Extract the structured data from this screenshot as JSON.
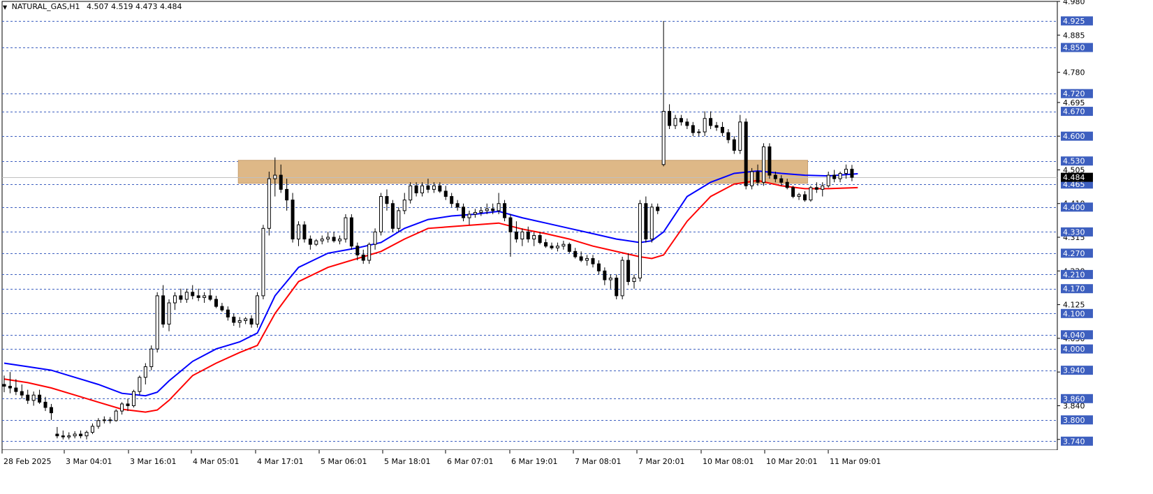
{
  "header": {
    "symbol": "NATURAL_GAS,H1",
    "ohlc": "4.507 4.519 4.473 4.484"
  },
  "colors": {
    "grid": "#3d5fbf",
    "candle": "#000000",
    "ema_fast": "#0000ff",
    "ema_slow": "#ff0000",
    "zone": "#deb887",
    "label_bg": "#3d5fbf",
    "last_price_bg": "#000000"
  },
  "chart_data": {
    "type": "candlestick",
    "ylim": [
      3.715,
      4.98
    ],
    "x_tick_labels": [
      "28 Feb 2025",
      "3 Mar 04:01",
      "3 Mar 16:01",
      "4 Mar 05:01",
      "4 Mar 17:01",
      "5 Mar 06:01",
      "5 Mar 18:01",
      "6 Mar 07:01",
      "6 Mar 19:01",
      "7 Mar 08:01",
      "7 Mar 20:01",
      "10 Mar 08:01",
      "10 Mar 20:01",
      "11 Mar 09:01"
    ],
    "y_axis_labels": [
      "4.980",
      "4.885",
      "4.780",
      "4.695",
      "4.600",
      "4.505",
      "4.410",
      "4.315",
      "4.220",
      "4.125",
      "4.030",
      "3.935",
      "3.840",
      "3.745"
    ],
    "grid_levels": [
      "4.925",
      "4.850",
      "4.720",
      "4.670",
      "4.600",
      "4.530",
      "4.465",
      "4.400",
      "4.330",
      "4.270",
      "4.210",
      "4.170",
      "4.100",
      "4.040",
      "4.000",
      "3.940",
      "3.860",
      "3.800",
      "3.740"
    ],
    "last_price": "4.484",
    "zone": {
      "x_start": 40,
      "x_end": 136,
      "y_low": 4.467,
      "y_high": 4.532
    },
    "candles": [
      [
        3.9,
        3.925,
        3.878,
        3.895
      ],
      [
        3.895,
        3.935,
        3.875,
        3.89
      ],
      [
        3.89,
        3.915,
        3.87,
        3.88
      ],
      [
        3.88,
        3.9,
        3.86,
        3.87
      ],
      [
        3.87,
        3.885,
        3.845,
        3.855
      ],
      [
        3.855,
        3.88,
        3.84,
        3.87
      ],
      [
        3.87,
        3.885,
        3.845,
        3.85
      ],
      [
        3.85,
        3.865,
        3.825,
        3.835
      ],
      [
        3.835,
        3.845,
        3.8,
        3.82
      ],
      [
        3.76,
        3.78,
        3.748,
        3.755
      ],
      [
        3.755,
        3.77,
        3.745,
        3.752
      ],
      [
        3.752,
        3.765,
        3.745,
        3.755
      ],
      [
        3.755,
        3.768,
        3.748,
        3.76
      ],
      [
        3.76,
        3.77,
        3.748,
        3.755
      ],
      [
        3.755,
        3.77,
        3.745,
        3.765
      ],
      [
        3.765,
        3.79,
        3.76,
        3.782
      ],
      [
        3.782,
        3.805,
        3.775,
        3.798
      ],
      [
        3.798,
        3.81,
        3.79,
        3.8
      ],
      [
        3.8,
        3.808,
        3.79,
        3.798
      ],
      [
        3.798,
        3.83,
        3.795,
        3.825
      ],
      [
        3.825,
        3.85,
        3.815,
        3.845
      ],
      [
        3.845,
        3.86,
        3.825,
        3.84
      ],
      [
        3.84,
        3.885,
        3.835,
        3.88
      ],
      [
        3.88,
        3.925,
        3.87,
        3.92
      ],
      [
        3.92,
        3.96,
        3.9,
        3.95
      ],
      [
        3.95,
        4.01,
        3.94,
        4.0
      ],
      [
        4.0,
        4.16,
        3.99,
        4.15
      ],
      [
        4.15,
        4.18,
        4.06,
        4.07
      ],
      [
        4.07,
        4.14,
        4.05,
        4.13
      ],
      [
        4.13,
        4.16,
        4.11,
        4.15
      ],
      [
        4.15,
        4.17,
        4.13,
        4.14
      ],
      [
        4.14,
        4.17,
        4.13,
        4.16
      ],
      [
        4.16,
        4.18,
        4.14,
        4.15
      ],
      [
        4.15,
        4.17,
        4.135,
        4.145
      ],
      [
        4.145,
        4.16,
        4.13,
        4.15
      ],
      [
        4.15,
        4.17,
        4.135,
        4.14
      ],
      [
        4.14,
        4.15,
        4.115,
        4.12
      ],
      [
        4.12,
        4.13,
        4.105,
        4.11
      ],
      [
        4.11,
        4.12,
        4.08,
        4.09
      ],
      [
        4.09,
        4.1,
        4.065,
        4.075
      ],
      [
        4.075,
        4.09,
        4.06,
        4.08
      ],
      [
        4.08,
        4.09,
        4.07,
        4.085
      ],
      [
        4.085,
        4.095,
        4.06,
        4.07
      ],
      [
        4.07,
        4.16,
        4.06,
        4.15
      ],
      [
        4.15,
        4.35,
        4.14,
        4.34
      ],
      [
        4.34,
        4.5,
        4.32,
        4.48
      ],
      [
        4.48,
        4.54,
        4.43,
        4.49
      ],
      [
        4.49,
        4.52,
        4.44,
        4.45
      ],
      [
        4.45,
        4.48,
        4.39,
        4.42
      ],
      [
        4.42,
        4.44,
        4.3,
        4.31
      ],
      [
        4.31,
        4.36,
        4.29,
        4.35
      ],
      [
        4.35,
        4.36,
        4.3,
        4.31
      ],
      [
        4.31,
        4.32,
        4.28,
        4.295
      ],
      [
        4.295,
        4.31,
        4.29,
        4.305
      ],
      [
        4.305,
        4.32,
        4.295,
        4.31
      ],
      [
        4.31,
        4.33,
        4.3,
        4.315
      ],
      [
        4.315,
        4.33,
        4.3,
        4.305
      ],
      [
        4.305,
        4.32,
        4.295,
        4.31
      ],
      [
        4.31,
        4.38,
        4.3,
        4.37
      ],
      [
        4.37,
        4.38,
        4.28,
        4.29
      ],
      [
        4.29,
        4.3,
        4.25,
        4.265
      ],
      [
        4.265,
        4.28,
        4.24,
        4.25
      ],
      [
        4.25,
        4.3,
        4.24,
        4.295
      ],
      [
        4.295,
        4.34,
        4.28,
        4.33
      ],
      [
        4.33,
        4.44,
        4.32,
        4.43
      ],
      [
        4.43,
        4.45,
        4.39,
        4.41
      ],
      [
        4.41,
        4.42,
        4.33,
        4.34
      ],
      [
        4.34,
        4.4,
        4.33,
        4.39
      ],
      [
        4.39,
        4.44,
        4.38,
        4.42
      ],
      [
        4.42,
        4.47,
        4.41,
        4.46
      ],
      [
        4.46,
        4.47,
        4.43,
        4.44
      ],
      [
        4.44,
        4.47,
        4.43,
        4.46
      ],
      [
        4.46,
        4.48,
        4.44,
        4.45
      ],
      [
        4.45,
        4.47,
        4.44,
        4.46
      ],
      [
        4.46,
        4.47,
        4.44,
        4.445
      ],
      [
        4.445,
        4.46,
        4.42,
        4.43
      ],
      [
        4.43,
        4.44,
        4.4,
        4.41
      ],
      [
        4.41,
        4.42,
        4.39,
        4.4
      ],
      [
        4.4,
        4.41,
        4.36,
        4.37
      ],
      [
        4.37,
        4.39,
        4.35,
        4.38
      ],
      [
        4.38,
        4.395,
        4.37,
        4.385
      ],
      [
        4.385,
        4.4,
        4.375,
        4.39
      ],
      [
        4.39,
        4.41,
        4.38,
        4.395
      ],
      [
        4.395,
        4.41,
        4.38,
        4.39
      ],
      [
        4.39,
        4.44,
        4.38,
        4.41
      ],
      [
        4.41,
        4.42,
        4.36,
        4.37
      ],
      [
        4.37,
        4.38,
        4.26,
        4.33
      ],
      [
        4.33,
        4.36,
        4.3,
        4.31
      ],
      [
        4.31,
        4.34,
        4.29,
        4.33
      ],
      [
        4.33,
        4.345,
        4.3,
        4.31
      ],
      [
        4.31,
        4.33,
        4.29,
        4.32
      ],
      [
        4.32,
        4.33,
        4.295,
        4.3
      ],
      [
        4.3,
        4.31,
        4.285,
        4.29
      ],
      [
        4.29,
        4.3,
        4.28,
        4.285
      ],
      [
        4.285,
        4.3,
        4.275,
        4.29
      ],
      [
        4.29,
        4.305,
        4.28,
        4.295
      ],
      [
        4.295,
        4.3,
        4.27,
        4.275
      ],
      [
        4.275,
        4.285,
        4.255,
        4.26
      ],
      [
        4.26,
        4.275,
        4.245,
        4.25
      ],
      [
        4.25,
        4.265,
        4.235,
        4.255
      ],
      [
        4.255,
        4.265,
        4.23,
        4.24
      ],
      [
        4.24,
        4.25,
        4.21,
        4.22
      ],
      [
        4.22,
        4.23,
        4.18,
        4.195
      ],
      [
        4.195,
        4.21,
        4.17,
        4.2
      ],
      [
        4.2,
        4.21,
        4.14,
        4.15
      ],
      [
        4.15,
        4.26,
        4.14,
        4.25
      ],
      [
        4.25,
        4.27,
        4.18,
        4.19
      ],
      [
        4.19,
        4.21,
        4.17,
        4.2
      ],
      [
        4.2,
        4.42,
        4.19,
        4.41
      ],
      [
        4.41,
        4.43,
        4.3,
        4.31
      ],
      [
        4.31,
        4.41,
        4.3,
        4.4
      ],
      [
        4.4,
        4.41,
        4.38,
        4.39
      ],
      [
        4.52,
        4.925,
        4.515,
        4.67
      ],
      [
        4.67,
        4.69,
        4.62,
        4.63
      ],
      [
        4.63,
        4.66,
        4.62,
        4.65
      ],
      [
        4.65,
        4.66,
        4.63,
        4.64
      ],
      [
        4.64,
        4.65,
        4.62,
        4.63
      ],
      [
        4.63,
        4.64,
        4.6,
        4.61
      ],
      [
        4.61,
        4.62,
        4.6,
        4.612
      ],
      [
        4.612,
        4.67,
        4.6,
        4.65
      ],
      [
        4.65,
        4.67,
        4.62,
        4.63
      ],
      [
        4.63,
        4.64,
        4.615,
        4.625
      ],
      [
        4.625,
        4.64,
        4.6,
        4.61
      ],
      [
        4.61,
        4.62,
        4.58,
        4.59
      ],
      [
        4.59,
        4.6,
        4.55,
        4.56
      ],
      [
        4.56,
        4.66,
        4.55,
        4.64
      ],
      [
        4.64,
        4.65,
        4.45,
        4.46
      ],
      [
        4.46,
        4.51,
        4.45,
        4.5
      ],
      [
        4.5,
        4.52,
        4.46,
        4.47
      ],
      [
        4.47,
        4.58,
        4.46,
        4.57
      ],
      [
        4.57,
        4.58,
        4.48,
        4.49
      ],
      [
        4.49,
        4.5,
        4.47,
        4.48
      ],
      [
        4.48,
        4.49,
        4.46,
        4.47
      ],
      [
        4.47,
        4.48,
        4.45,
        4.455
      ],
      [
        4.455,
        4.46,
        4.425,
        4.43
      ],
      [
        4.43,
        4.44,
        4.42,
        4.435
      ],
      [
        4.435,
        4.445,
        4.415,
        4.42
      ],
      [
        4.42,
        4.46,
        4.415,
        4.455
      ],
      [
        4.455,
        4.47,
        4.44,
        4.45
      ],
      [
        4.45,
        4.47,
        4.43,
        4.46
      ],
      [
        4.46,
        4.5,
        4.455,
        4.49
      ],
      [
        4.49,
        4.505,
        4.47,
        4.48
      ],
      [
        4.48,
        4.5,
        4.47,
        4.495
      ],
      [
        4.495,
        4.52,
        4.48,
        4.507
      ],
      [
        4.507,
        4.519,
        4.473,
        4.484
      ]
    ],
    "ema_fast": [
      [
        0,
        3.96
      ],
      [
        4,
        3.95
      ],
      [
        8,
        3.94
      ],
      [
        12,
        3.92
      ],
      [
        16,
        3.9
      ],
      [
        20,
        3.875
      ],
      [
        24,
        3.868
      ],
      [
        26,
        3.878
      ],
      [
        28,
        3.91
      ],
      [
        32,
        3.965
      ],
      [
        36,
        4.0
      ],
      [
        40,
        4.02
      ],
      [
        43,
        4.045
      ],
      [
        46,
        4.15
      ],
      [
        50,
        4.23
      ],
      [
        55,
        4.27
      ],
      [
        60,
        4.285
      ],
      [
        64,
        4.3
      ],
      [
        68,
        4.34
      ],
      [
        72,
        4.365
      ],
      [
        76,
        4.375
      ],
      [
        80,
        4.38
      ],
      [
        84,
        4.388
      ],
      [
        88,
        4.37
      ],
      [
        92,
        4.355
      ],
      [
        96,
        4.34
      ],
      [
        100,
        4.325
      ],
      [
        104,
        4.31
      ],
      [
        108,
        4.3
      ],
      [
        110,
        4.305
      ],
      [
        112,
        4.33
      ],
      [
        116,
        4.43
      ],
      [
        120,
        4.47
      ],
      [
        124,
        4.495
      ],
      [
        128,
        4.502
      ],
      [
        132,
        4.495
      ],
      [
        136,
        4.49
      ],
      [
        140,
        4.488
      ],
      [
        145,
        4.494
      ]
    ],
    "ema_slow": [
      [
        0,
        3.915
      ],
      [
        4,
        3.905
      ],
      [
        8,
        3.89
      ],
      [
        12,
        3.87
      ],
      [
        16,
        3.85
      ],
      [
        20,
        3.83
      ],
      [
        24,
        3.822
      ],
      [
        26,
        3.828
      ],
      [
        28,
        3.855
      ],
      [
        32,
        3.925
      ],
      [
        36,
        3.96
      ],
      [
        40,
        3.99
      ],
      [
        43,
        4.01
      ],
      [
        46,
        4.1
      ],
      [
        50,
        4.19
      ],
      [
        55,
        4.23
      ],
      [
        60,
        4.255
      ],
      [
        64,
        4.275
      ],
      [
        68,
        4.31
      ],
      [
        72,
        4.34
      ],
      [
        76,
        4.345
      ],
      [
        80,
        4.35
      ],
      [
        84,
        4.355
      ],
      [
        88,
        4.338
      ],
      [
        92,
        4.325
      ],
      [
        96,
        4.31
      ],
      [
        100,
        4.29
      ],
      [
        104,
        4.275
      ],
      [
        108,
        4.26
      ],
      [
        110,
        4.255
      ],
      [
        112,
        4.265
      ],
      [
        116,
        4.36
      ],
      [
        120,
        4.43
      ],
      [
        124,
        4.465
      ],
      [
        128,
        4.475
      ],
      [
        132,
        4.46
      ],
      [
        136,
        4.452
      ],
      [
        140,
        4.452
      ],
      [
        145,
        4.455
      ]
    ]
  }
}
